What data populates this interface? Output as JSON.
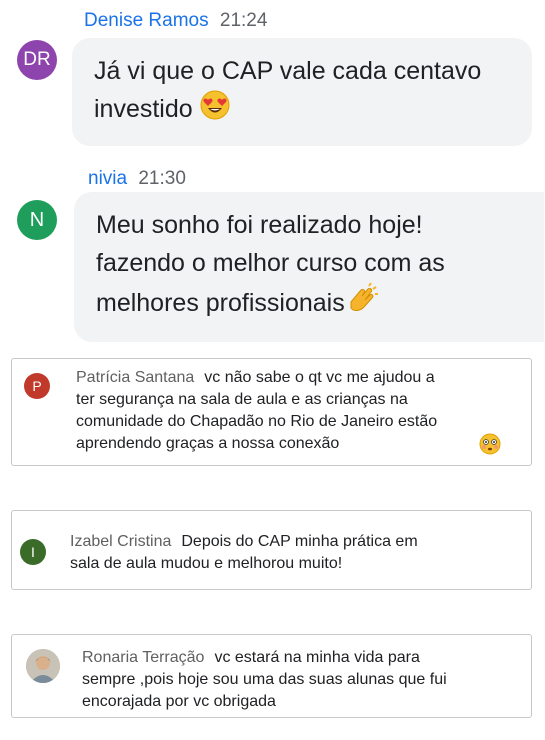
{
  "chats": [
    {
      "author": "Denise Ramos",
      "time": "21:24",
      "initials": "DR",
      "avatar_color": "#8e44ad",
      "line1": "Já vi que o CAP vale cada centavo",
      "line2": "investido",
      "emoji": "heart-eyes"
    },
    {
      "author": "nivia",
      "time": "21:30",
      "initials": "N",
      "avatar_color": "#1e9e5a",
      "line1": "Meu sonho foi realizado hoje!",
      "line2": "fazendo o melhor curso com as",
      "line3": "melhores profissionais",
      "emoji": "clapping-hands"
    }
  ],
  "comments": [
    {
      "author": "Patrícia Santana",
      "initial": "P",
      "avatar_color": "#c0392b",
      "first": "vc não sabe o qt vc me ajudou a",
      "line2": "ter segurança na sala de aula e as crianças na",
      "line3": "comunidade do Chapadão no Rio de Janeiro estão",
      "line4": "aprendendo graças a nossa conexão"
    },
    {
      "author": "Izabel Cristina",
      "initial": "I",
      "avatar_color": "#3a6b28",
      "first": "Depois do CAP minha prática em",
      "line2": "sala de aula mudou e melhorou muito!"
    },
    {
      "author": "Ronaria Terração",
      "avatar": "photo",
      "first": "vc estará na minha vida para",
      "line2": "sempre ,pois hoje sou uma das suas alunas que fui",
      "line3": "encorajada por vc obrigada"
    }
  ]
}
